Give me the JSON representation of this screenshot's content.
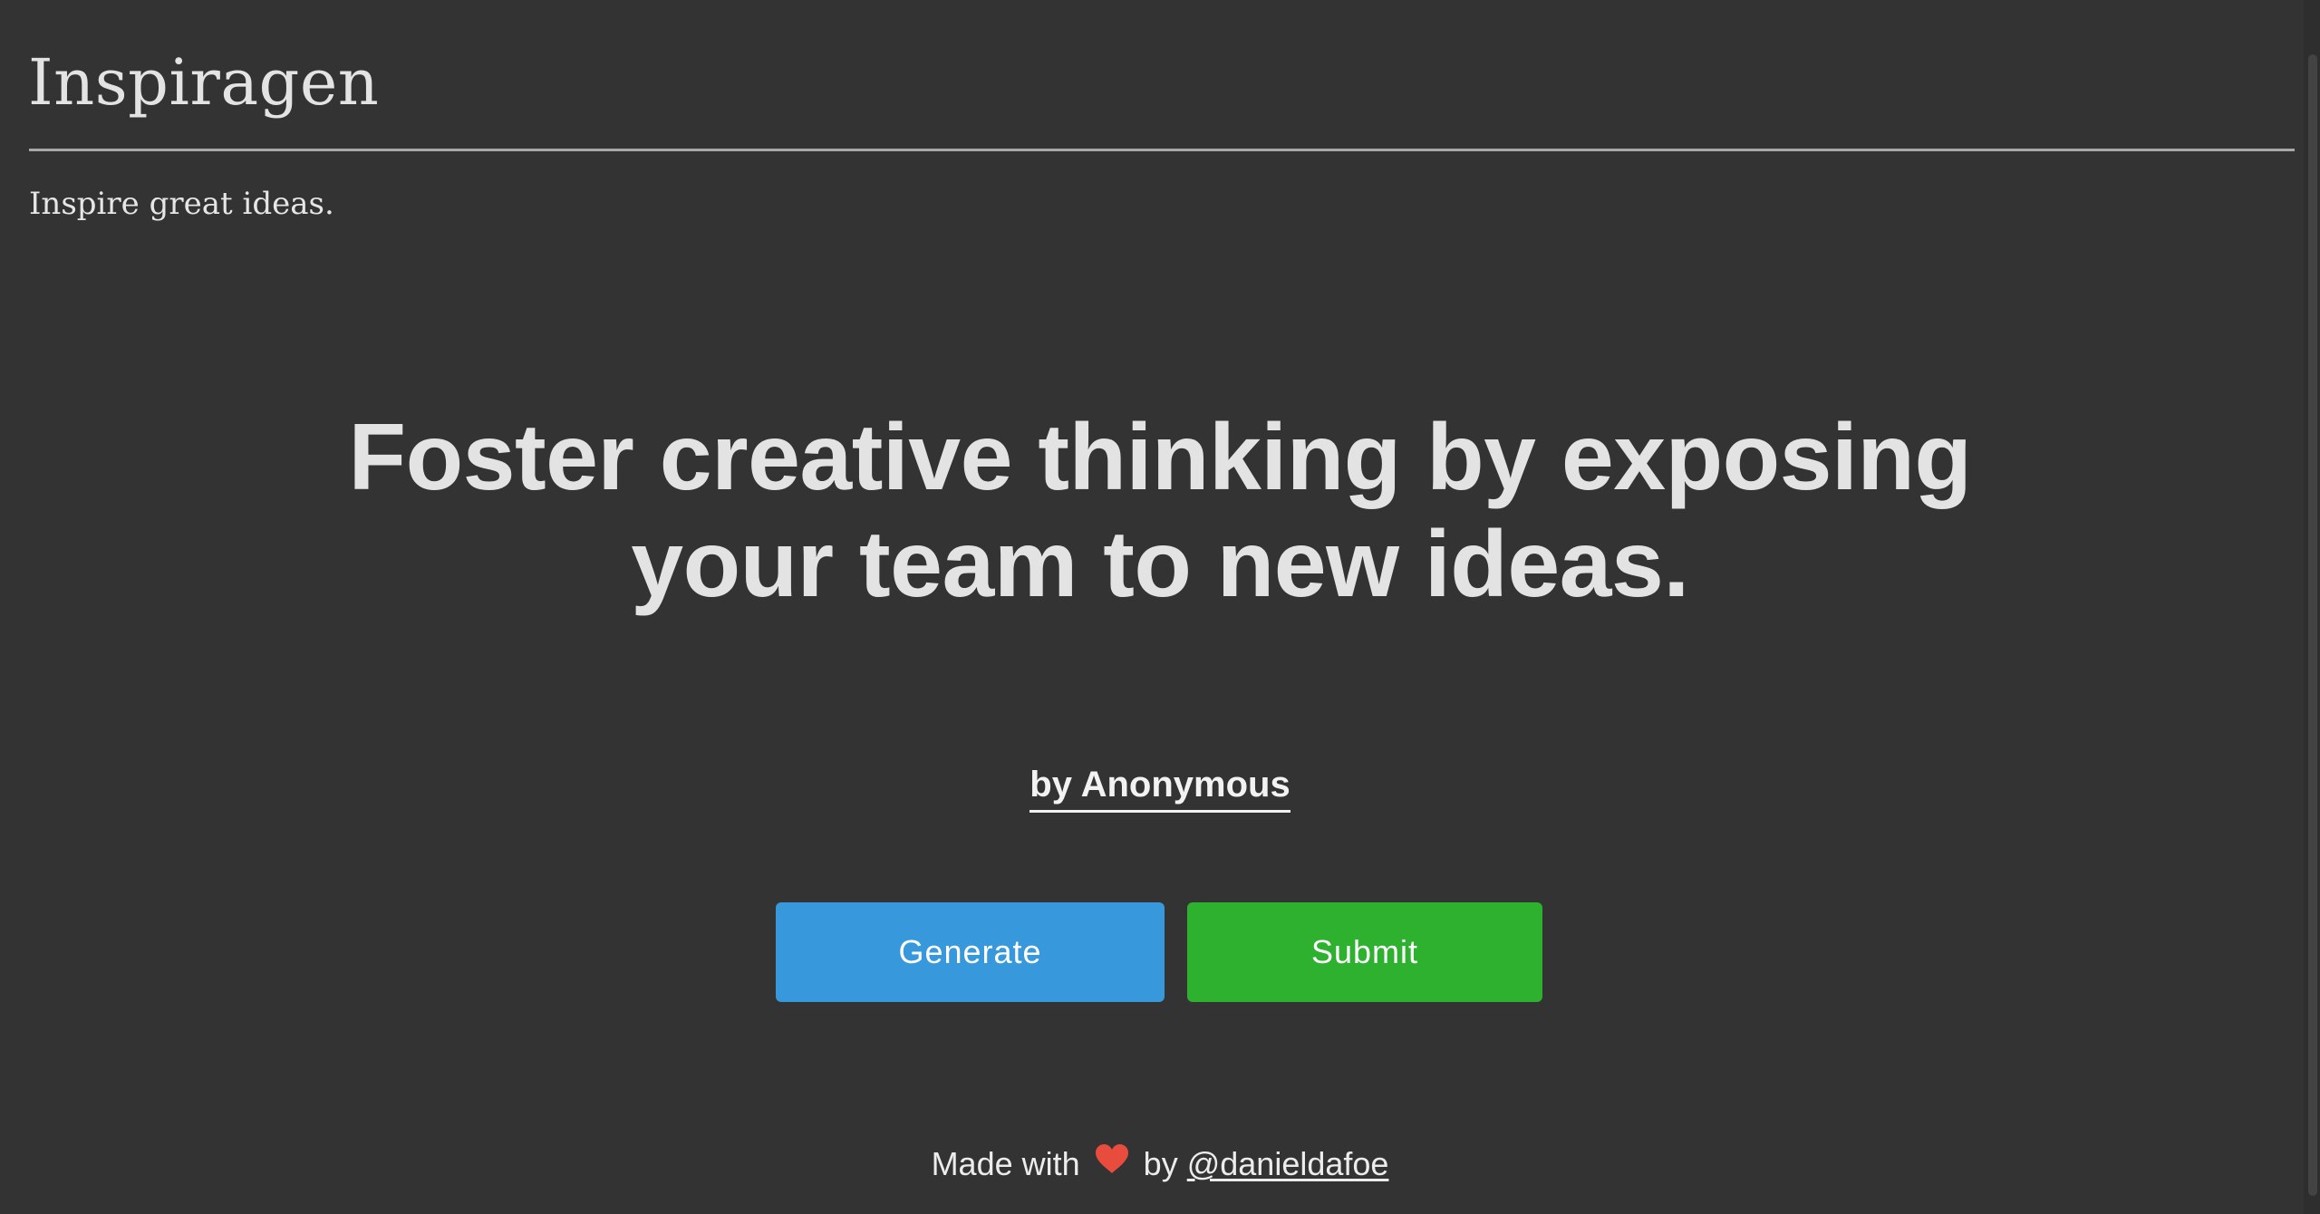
{
  "header": {
    "title": "Inspiragen",
    "tagline": "Inspire great ideas."
  },
  "quote": {
    "text": "Foster creative thinking by exposing your team to new ideas.",
    "author": "by Anonymous"
  },
  "actions": {
    "generate_label": "Generate",
    "submit_label": "Submit"
  },
  "footer": {
    "made_with": "Made with",
    "by": "by",
    "handle": "@danieldafoe"
  },
  "colors": {
    "background": "#333333",
    "generate": "#3898dc",
    "submit": "#2db12f",
    "heart": "#e74c3c"
  },
  "icons": {
    "heart": "heart-icon"
  }
}
